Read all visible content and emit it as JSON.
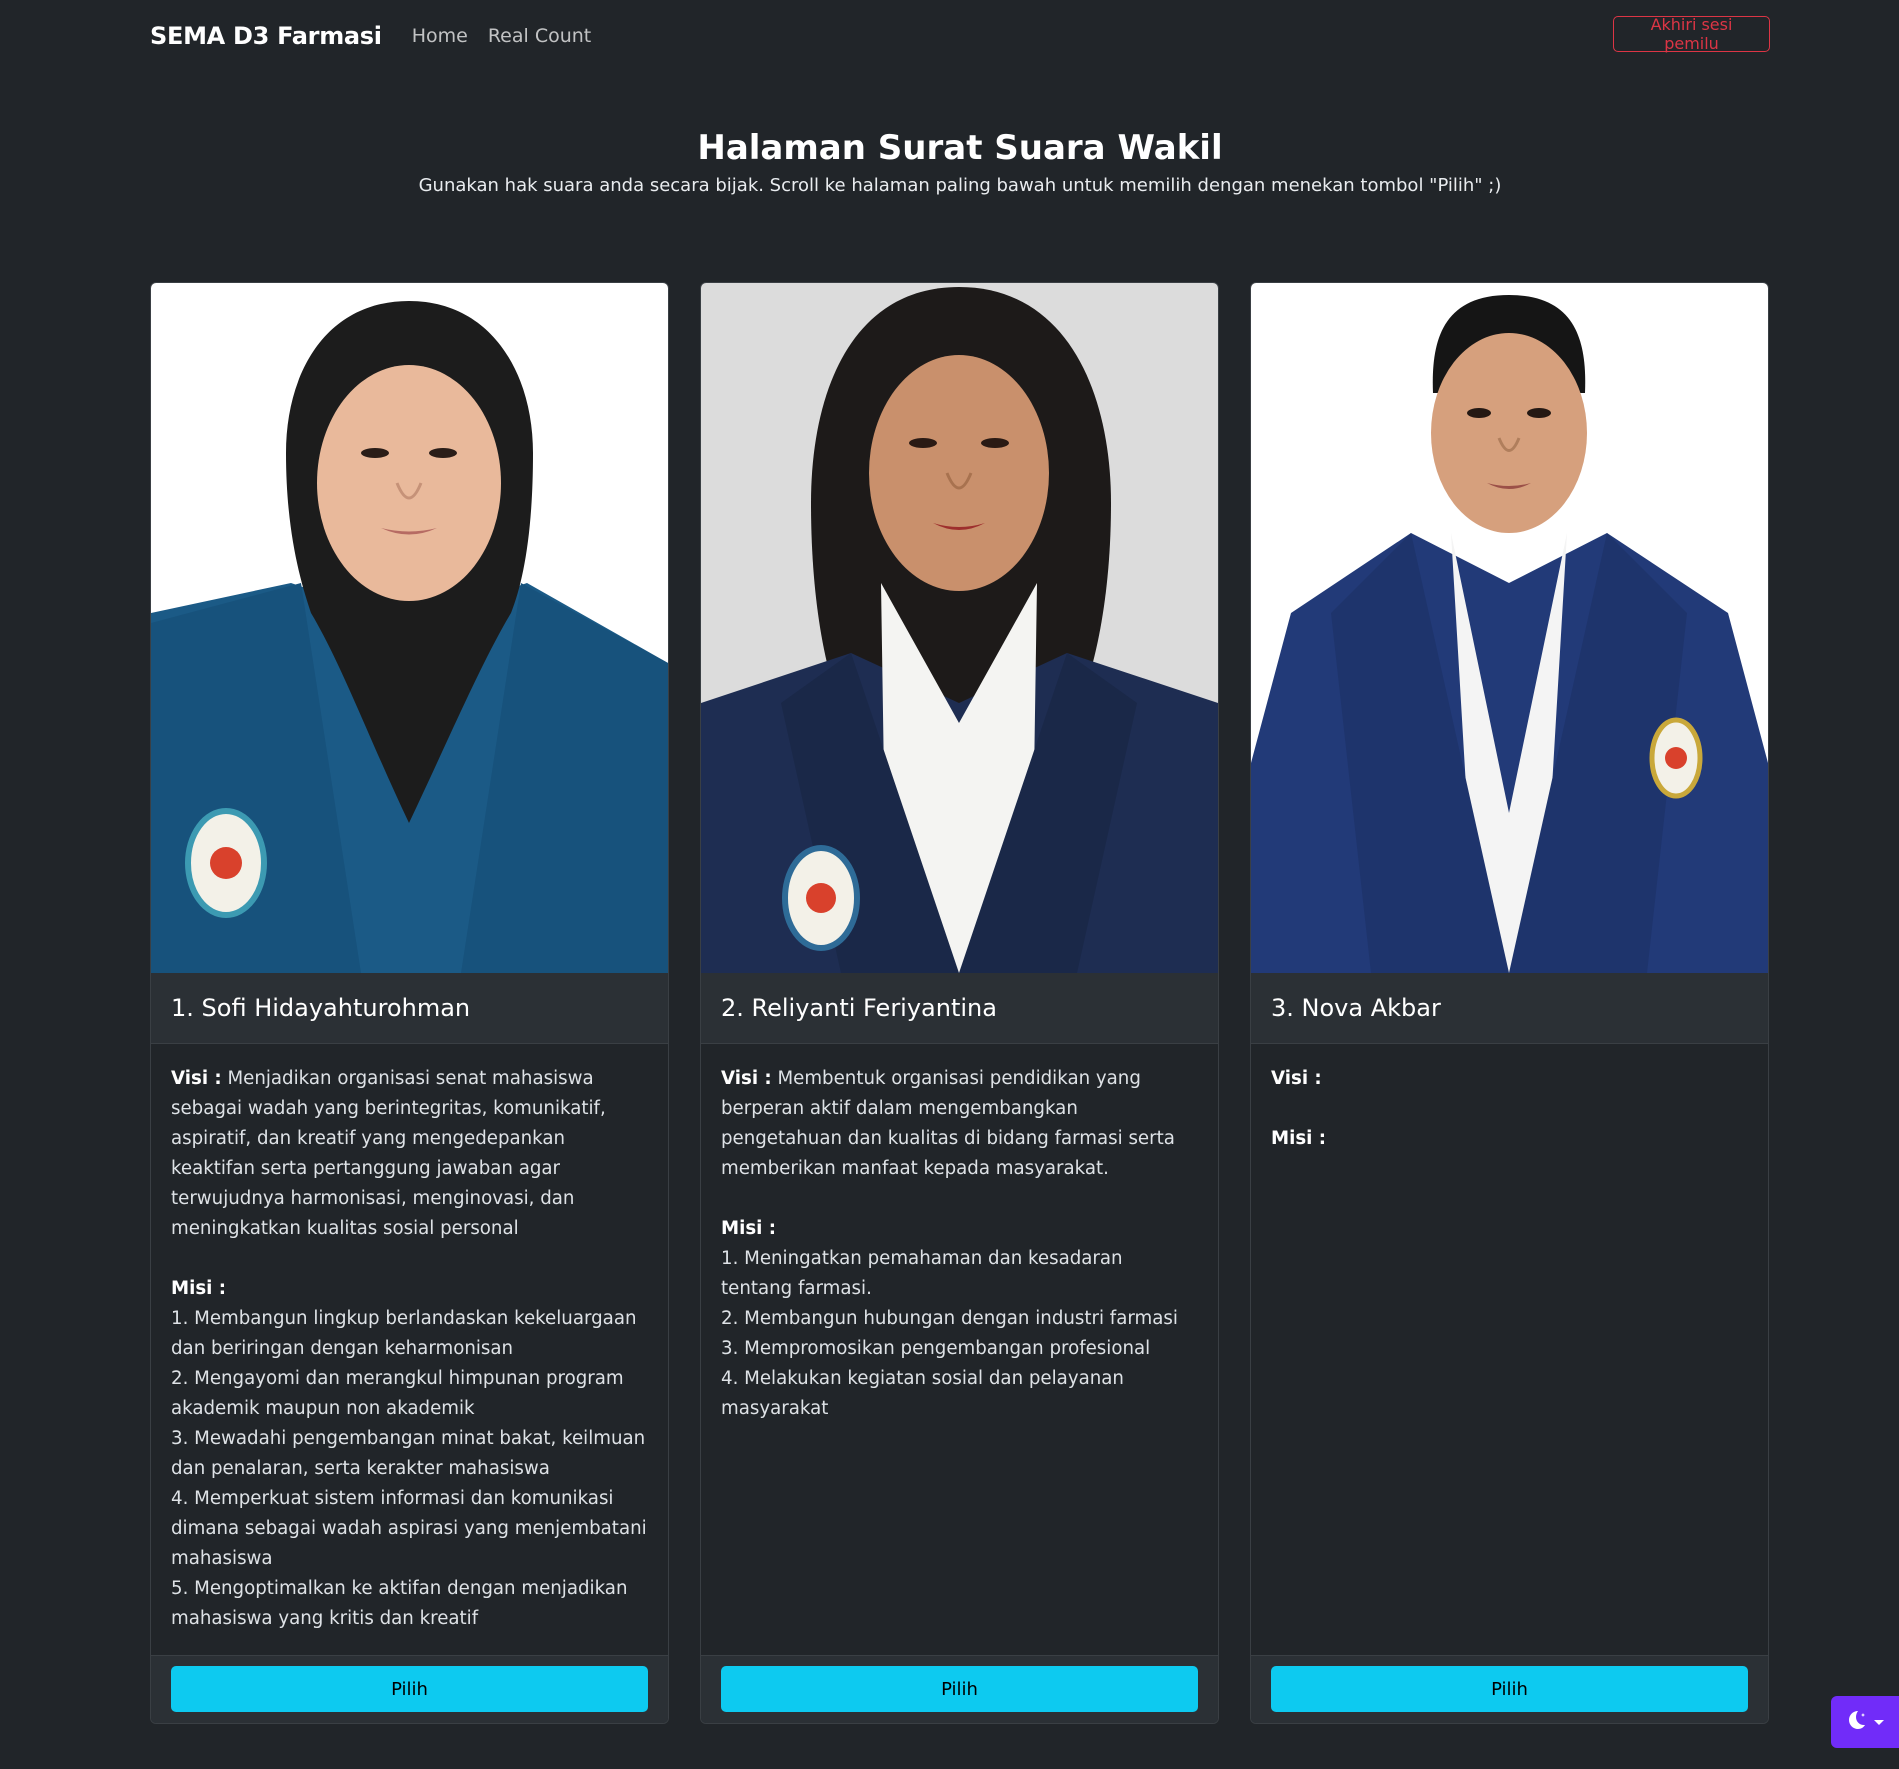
{
  "navbar": {
    "brand": "SEMA D3 Farmasi",
    "links": [
      "Home",
      "Real Count"
    ],
    "end_session": "Akhiri sesi pemilu"
  },
  "header": {
    "title": "Halaman Surat Suara Wakil",
    "subtitle": "Gunakan hak suara anda secara bijak. Scroll ke halaman paling bawah untuk memilih dengan menekan tombol \"Pilih\" ;)"
  },
  "labels": {
    "visi": "Visi :",
    "misi": "Misi :",
    "pilih": "Pilih"
  },
  "candidates": [
    {
      "name": "1. Sofi Hidayahturohman",
      "visi": "Menjadikan organisasi senat mahasiswa sebagai wadah yang berintegritas, komunikatif, aspiratif, dan kreatif yang mengedepankan keaktifan serta pertanggung jawaban agar terwujudnya harmonisasi, menginovasi, dan meningkatkan kualitas sosial personal",
      "misi": [
        "1. Membangun lingkup berlandaskan kekeluargaan dan beriringan dengan keharmonisan",
        "2. Mengayomi dan merangkul himpunan program akademik maupun non akademik",
        "3. Mewadahi pengembangan minat bakat, keilmuan dan penalaran, serta kerakter mahasiswa",
        "4. Memperkuat sistem informasi dan komunikasi dimana sebagai wadah aspirasi yang menjembatani mahasiswa",
        "5. Mengoptimalkan ke aktifan dengan menjadikan mahasiswa yang kritis dan kreatif"
      ]
    },
    {
      "name": "2. Reliyanti Feriyantina",
      "visi": "Membentuk organisasi pendidikan yang berperan aktif dalam mengembangkan pengetahuan dan kualitas di bidang farmasi serta memberikan manfaat kepada masyarakat.",
      "misi": [
        "1. Meningatkan pemahaman dan kesadaran tentang farmasi.",
        "2. Membangun hubungan dengan industri farmasi",
        "3. Mempromosikan pengembangan profesional",
        "4. Melakukan kegiatan sosial dan pelayanan masyarakat"
      ]
    },
    {
      "name": "3. Nova Akbar",
      "visi": "",
      "misi": []
    }
  ],
  "theme_toggle_icon": "moon-stars-icon"
}
